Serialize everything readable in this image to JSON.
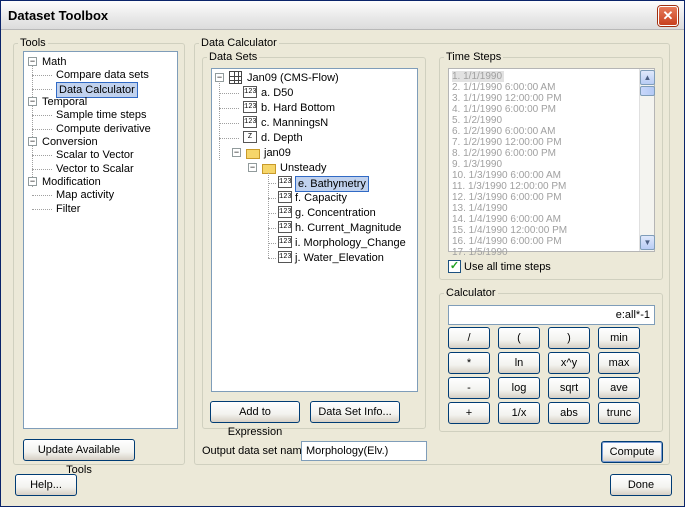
{
  "window": {
    "title": "Dataset Toolbox",
    "close_glyph": "✕"
  },
  "tools": {
    "legend": "Tools",
    "groups": [
      {
        "label": "Math",
        "expander": "−",
        "items": [
          "Compare data sets",
          "Data Calculator"
        ]
      },
      {
        "label": "Temporal",
        "expander": "−",
        "items": [
          "Sample time steps",
          "Compute derivative"
        ]
      },
      {
        "label": "Conversion",
        "expander": "−",
        "items": [
          "Scalar to Vector",
          "Vector to Scalar"
        ]
      },
      {
        "label": "Modification",
        "expander": "−",
        "items": [
          "Map activity",
          "Filter"
        ]
      }
    ],
    "selected": "Data Calculator",
    "update_button": "Update Available Tools"
  },
  "data_calculator": {
    "legend": "Data Calculator",
    "data_sets": {
      "legend": "Data Sets",
      "root": {
        "label": "Jan09 (CMS-Flow)",
        "expander": "−"
      },
      "root_items": [
        {
          "icon": "123",
          "label": "a. D50"
        },
        {
          "icon": "123",
          "label": "b. Hard Bottom"
        },
        {
          "icon": "123",
          "label": "c. ManningsN"
        },
        {
          "icon": "Z",
          "label": "d. Depth"
        }
      ],
      "folder": {
        "label": "jan09",
        "expander": "−"
      },
      "subfolder": {
        "label": "Unsteady",
        "expander": "−"
      },
      "sub_items": [
        {
          "icon": "123",
          "label": "e. Bathymetry"
        },
        {
          "icon": "123",
          "label": "f. Capacity"
        },
        {
          "icon": "123",
          "label": "g. Concentration"
        },
        {
          "icon": "123",
          "label": "h. Current_Magnitude"
        },
        {
          "icon": "123",
          "label": "i. Morphology_Change"
        },
        {
          "icon": "123",
          "label": "j. Water_Elevation"
        }
      ],
      "selected": "e. Bathymetry",
      "add_button": "Add to Expression",
      "info_button": "Data Set Info..."
    },
    "time_steps": {
      "legend": "Time Steps",
      "items": [
        "1. 1/1/1990",
        "2. 1/1/1990 6:00:00 AM",
        "3. 1/1/1990 12:00:00 PM",
        "4. 1/1/1990 6:00:00 PM",
        "5. 1/2/1990",
        "6. 1/2/1990 6:00:00 AM",
        "7. 1/2/1990 12:00:00 PM",
        "8. 1/2/1990 6:00:00 PM",
        "9. 1/3/1990",
        "10. 1/3/1990 6:00:00 AM",
        "11. 1/3/1990 12:00:00 PM",
        "12. 1/3/1990 6:00:00 PM",
        "13. 1/4/1990",
        "14. 1/4/1990 6:00:00 AM",
        "15. 1/4/1990 12:00:00 PM",
        "16. 1/4/1990 6:00:00 PM",
        "17. 1/5/1990"
      ],
      "use_all_label": "Use all time steps",
      "use_all_checked": true,
      "check_glyph": "✓",
      "scroll_up": "▲",
      "scroll_down": "▼"
    },
    "calculator": {
      "legend": "Calculator",
      "expression": "e:all*-1",
      "buttons": [
        [
          "/",
          "(",
          ")",
          "min"
        ],
        [
          "*",
          "ln",
          "x^y",
          "max"
        ],
        [
          "-",
          "log",
          "sqrt",
          "ave"
        ],
        [
          "+",
          "1/x",
          "abs",
          "trunc"
        ]
      ]
    },
    "output_label": "Output data set name:",
    "output_value": "Morphology(Elv.)",
    "compute_button": "Compute"
  },
  "footer": {
    "help_button": "Help...",
    "done_button": "Done"
  },
  "colors": {
    "accent": "#316ac5",
    "selection": "#c1d2ee",
    "dialog": "#ece9d8"
  }
}
